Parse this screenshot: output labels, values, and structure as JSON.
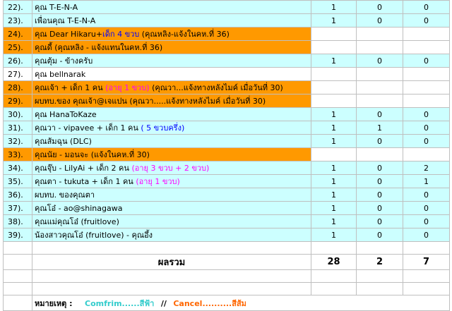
{
  "rows": [
    {
      "idx": "22).",
      "name": "คุณ T-E-N-A",
      "extra": "",
      "extra_color": "",
      "rest": "",
      "v1": "1",
      "v2": "0",
      "v3": "0",
      "status": "confirm"
    },
    {
      "idx": "23).",
      "name": "เพื่อนคุณ  T-E-N-A",
      "extra": "",
      "extra_color": "",
      "rest": "",
      "v1": "1",
      "v2": "0",
      "v3": "0",
      "status": "confirm"
    },
    {
      "idx": "24).",
      "name": "คุณ Dear Hikaru+",
      "extra": "เด็ก 4 ขวบ",
      "extra_color": "blue",
      "rest": " (คุณหลิง-แจ้งในคห.ที่ 36)",
      "v1": "",
      "v2": "",
      "v3": "",
      "status": "cancel"
    },
    {
      "idx": "25).",
      "name": "คุณดี้   (คุณหลิง - แจ้งแทนในคห.ที่ 36)",
      "extra": "",
      "extra_color": "",
      "rest": "",
      "v1": "",
      "v2": "",
      "v3": "",
      "status": "cancel"
    },
    {
      "idx": "26).",
      "name": "คุณตุ้ม - ข้างครับ",
      "extra": "",
      "extra_color": "",
      "rest": "",
      "v1": "1",
      "v2": "0",
      "v3": "0",
      "status": "confirm"
    },
    {
      "idx": "27).",
      "name": "คุณ bellnarak",
      "extra": "",
      "extra_color": "",
      "rest": "",
      "v1": "",
      "v2": "",
      "v3": "",
      "status": "none"
    },
    {
      "idx": "28).",
      "name": "คุณเจ้า + เด็ก 1 คน ",
      "extra": "(อายุ 1 ขวบ)",
      "extra_color": "pink",
      "rest": " (คุณวา...แจ้งทางหลังไมค์ เมื่อวันที่ 30)",
      "v1": "",
      "v2": "",
      "v3": "",
      "status": "cancel"
    },
    {
      "idx": "29).",
      "name": "ผบทบ.ของ คุณเจ้า@เจแปน   (คุณวา.....แจ้งทางหลังไมค์ เมื่อวันที่ 30)",
      "extra": "",
      "extra_color": "",
      "rest": "",
      "v1": "",
      "v2": "",
      "v3": "",
      "status": "cancel"
    },
    {
      "idx": "30).",
      "name": "คุณ HanaToKaze",
      "extra": "",
      "extra_color": "",
      "rest": "",
      "v1": "1",
      "v2": "0",
      "v3": "0",
      "status": "confirm"
    },
    {
      "idx": "31).",
      "name": "คุณวา - vipavee  + เด็ก 1 คน  ",
      "extra": "( 5 ขวบครึ่ง)",
      "extra_color": "blue",
      "rest": "",
      "v1": "1",
      "v2": "1",
      "v3": "0",
      "status": "confirm"
    },
    {
      "idx": "32).",
      "name": "คุณส้มฉุน (DLC)",
      "extra": "",
      "extra_color": "",
      "rest": "",
      "v1": "1",
      "v2": "0",
      "v3": "0",
      "status": "confirm"
    },
    {
      "idx": "33).",
      "name": "คุณนัย - มอนจะ   (แจ้งในคห.ที่ 30)",
      "extra": "",
      "extra_color": "",
      "rest": "",
      "v1": "",
      "v2": "",
      "v3": "",
      "status": "cancel"
    },
    {
      "idx": "34).",
      "name": "คุณจุ๊บ - LilyAi + เด็ก 2 คน ",
      "extra": "(อายุ 3 ขวบ + 2 ขวบ)",
      "extra_color": "pink",
      "rest": "",
      "v1": "1",
      "v2": "0",
      "v3": "2",
      "status": "confirm"
    },
    {
      "idx": "35).",
      "name": "คุณตา - tukuta + เด็ก 1 คน ",
      "extra": "(อายุ 1 ขวบ)",
      "extra_color": "pink",
      "rest": "",
      "v1": "1",
      "v2": "0",
      "v3": "1",
      "status": "confirm"
    },
    {
      "idx": "36).",
      "name": "ผบทบ. ของคุณตา",
      "extra": "",
      "extra_color": "",
      "rest": "",
      "v1": "1",
      "v2": "0",
      "v3": "0",
      "status": "confirm"
    },
    {
      "idx": "37).",
      "name": "คุณโอ๋ - ao@shinagawa",
      "extra": "",
      "extra_color": "",
      "rest": "",
      "v1": "1",
      "v2": "0",
      "v3": "0",
      "status": "confirm"
    },
    {
      "idx": "38).",
      "name": "คุณแม่คุณโอ๋ (fruitlove)",
      "extra": "",
      "extra_color": "",
      "rest": "",
      "v1": "1",
      "v2": "0",
      "v3": "0",
      "status": "confirm"
    },
    {
      "idx": "39).",
      "name": "น้องสาวคุณโอ๋ (fruitlove)  - คุณอึ้ง",
      "extra": "",
      "extra_color": "",
      "rest": "",
      "v1": "1",
      "v2": "0",
      "v3": "0",
      "status": "confirm"
    }
  ],
  "total": {
    "label": "ผลรวม",
    "v1": "28",
    "v2": "2",
    "v3": "7"
  },
  "note": {
    "label": "หมายเหตุ :",
    "confirm": "Comfrim......สีฟ้า",
    "separator": "//",
    "cancel": "Cancel..........สีส้ม"
  },
  "colors": {
    "confirm": "#ccffff",
    "cancel": "#ff9900",
    "pink": "#ff00ff",
    "blue": "#0000ff"
  }
}
